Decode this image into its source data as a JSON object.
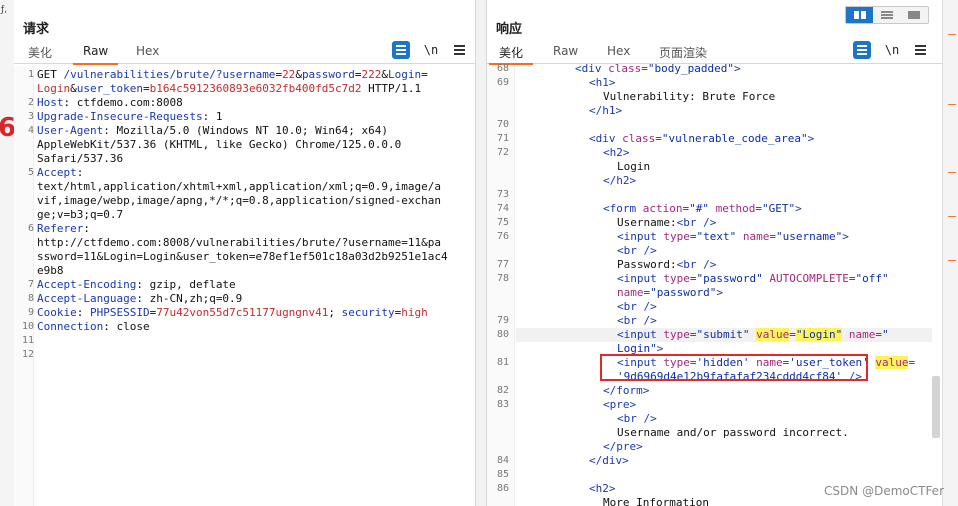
{
  "request_pane": {
    "title": "请求",
    "tabs": [
      "美化",
      "Raw",
      "Hex"
    ],
    "active_tab": "Raw",
    "newline_toggle": "\\n",
    "lines": [
      {
        "n": "1",
        "parts": [
          [
            "t",
            "GET "
          ],
          [
            "b",
            "/vulnerabilities/brute/?"
          ],
          [
            "k",
            "username"
          ],
          [
            "t",
            "="
          ],
          [
            "r",
            "22"
          ],
          [
            "t",
            "&"
          ],
          [
            "k",
            "password"
          ],
          [
            "t",
            "="
          ],
          [
            "r",
            "222"
          ],
          [
            "t",
            "&"
          ],
          [
            "k",
            "Login"
          ],
          [
            "t",
            "="
          ]
        ]
      },
      {
        "n": "",
        "parts": [
          [
            "r",
            "Login"
          ],
          [
            "t",
            "&"
          ],
          [
            "k",
            "user_token"
          ],
          [
            "t",
            "="
          ],
          [
            "r",
            "b164c5912360893e6032fb400fd5c7d2"
          ],
          [
            "t",
            " HTTP/1.1"
          ]
        ]
      },
      {
        "n": "2",
        "parts": [
          [
            "k",
            "Host"
          ],
          [
            "t",
            ": ctfdemo.com:8008"
          ]
        ]
      },
      {
        "n": "3",
        "parts": [
          [
            "k",
            "Upgrade-Insecure-Requests"
          ],
          [
            "t",
            ": 1"
          ]
        ]
      },
      {
        "n": "4",
        "parts": [
          [
            "k",
            "User-Agent"
          ],
          [
            "t",
            ": Mozilla/5.0 (Windows NT 10.0; Win64; x64)"
          ]
        ]
      },
      {
        "n": "",
        "parts": [
          [
            "t",
            "AppleWebKit/537.36 (KHTML, like Gecko) Chrome/125.0.0.0"
          ]
        ]
      },
      {
        "n": "",
        "parts": [
          [
            "t",
            "Safari/537.36"
          ]
        ]
      },
      {
        "n": "5",
        "parts": [
          [
            "k",
            "Accept"
          ],
          [
            "t",
            ":"
          ]
        ]
      },
      {
        "n": "",
        "parts": [
          [
            "t",
            "text/html,application/xhtml+xml,application/xml;q=0.9,image/a"
          ]
        ]
      },
      {
        "n": "",
        "parts": [
          [
            "t",
            "vif,image/webp,image/apng,*/*;q=0.8,application/signed-exchan"
          ]
        ]
      },
      {
        "n": "",
        "parts": [
          [
            "t",
            "ge;v=b3;q=0.7"
          ]
        ]
      },
      {
        "n": "6",
        "parts": [
          [
            "k",
            "Referer"
          ],
          [
            "t",
            ":"
          ]
        ]
      },
      {
        "n": "",
        "parts": [
          [
            "t",
            "http://ctfdemo.com:8008/vulnerabilities/brute/?username=11&pa"
          ]
        ]
      },
      {
        "n": "",
        "parts": [
          [
            "t",
            "ssword=11&Login=Login&user_token=e78ef1ef501c18a03d2b9251e1ac4"
          ]
        ]
      },
      {
        "n": "",
        "parts": [
          [
            "t",
            "e9b8"
          ]
        ]
      },
      {
        "n": "7",
        "parts": [
          [
            "k",
            "Accept-Encoding"
          ],
          [
            "t",
            ": gzip, deflate"
          ]
        ]
      },
      {
        "n": "8",
        "parts": [
          [
            "k",
            "Accept-Language"
          ],
          [
            "t",
            ": zh-CN,zh;q=0.9"
          ]
        ]
      },
      {
        "n": "9",
        "parts": [
          [
            "k",
            "Cookie"
          ],
          [
            "t",
            ": "
          ],
          [
            "k",
            "PHPSESSID"
          ],
          [
            "t",
            "="
          ],
          [
            "r",
            "77u42von55d7c51177ugngnv41"
          ],
          [
            "t",
            "; "
          ],
          [
            "k",
            "security"
          ],
          [
            "t",
            "="
          ],
          [
            "r",
            "high"
          ]
        ]
      },
      {
        "n": "10",
        "parts": [
          [
            "k",
            "Connection"
          ],
          [
            "t",
            ": close"
          ]
        ]
      },
      {
        "n": "11",
        "parts": []
      },
      {
        "n": "12",
        "parts": []
      }
    ]
  },
  "response_pane": {
    "title": "响应",
    "tabs": [
      "美化",
      "Raw",
      "Hex",
      "页面渲染"
    ],
    "active_tab": "美化",
    "newline_toggle": "\\n",
    "lines": [
      {
        "n": "68",
        "indent": 4,
        "parts": [
          [
            "tag",
            "<div "
          ],
          [
            "attr",
            "class"
          ],
          [
            "tag",
            "="
          ],
          [
            "str",
            "\"body_padded\""
          ],
          [
            "tag",
            ">"
          ]
        ]
      },
      {
        "n": "69",
        "indent": 5,
        "parts": [
          [
            "tag",
            "<h1>"
          ]
        ]
      },
      {
        "n": "",
        "indent": 6,
        "parts": [
          [
            "txt",
            "Vulnerability: Brute Force"
          ]
        ]
      },
      {
        "n": "",
        "indent": 5,
        "parts": [
          [
            "tag",
            "</h1>"
          ]
        ]
      },
      {
        "n": "70",
        "indent": 0,
        "parts": []
      },
      {
        "n": "71",
        "indent": 5,
        "parts": [
          [
            "tag",
            "<div "
          ],
          [
            "attr",
            "class"
          ],
          [
            "tag",
            "="
          ],
          [
            "str",
            "\"vulnerable_code_area\""
          ],
          [
            "tag",
            ">"
          ]
        ]
      },
      {
        "n": "72",
        "indent": 6,
        "parts": [
          [
            "tag",
            "<h2>"
          ]
        ]
      },
      {
        "n": "",
        "indent": 7,
        "parts": [
          [
            "txt",
            "Login"
          ]
        ]
      },
      {
        "n": "",
        "indent": 6,
        "parts": [
          [
            "tag",
            "</h2>"
          ]
        ]
      },
      {
        "n": "73",
        "indent": 0,
        "parts": []
      },
      {
        "n": "74",
        "indent": 6,
        "parts": [
          [
            "tag",
            "<form "
          ],
          [
            "attr",
            "action"
          ],
          [
            "tag",
            "="
          ],
          [
            "str",
            "\"#\""
          ],
          [
            "tag",
            " "
          ],
          [
            "attr",
            "method"
          ],
          [
            "tag",
            "="
          ],
          [
            "str",
            "\"GET\""
          ],
          [
            "tag",
            ">"
          ]
        ]
      },
      {
        "n": "75",
        "indent": 7,
        "parts": [
          [
            "txt",
            "Username:"
          ],
          [
            "tag",
            "<br />"
          ]
        ]
      },
      {
        "n": "76",
        "indent": 7,
        "parts": [
          [
            "tag",
            "<input "
          ],
          [
            "attr",
            "type"
          ],
          [
            "tag",
            "="
          ],
          [
            "str",
            "\"text\""
          ],
          [
            "tag",
            " "
          ],
          [
            "attr",
            "name"
          ],
          [
            "tag",
            "="
          ],
          [
            "str",
            "\"username\""
          ],
          [
            "tag",
            ">"
          ]
        ]
      },
      {
        "n": "",
        "indent": 7,
        "parts": [
          [
            "tag",
            "<br />"
          ]
        ]
      },
      {
        "n": "77",
        "indent": 7,
        "parts": [
          [
            "txt",
            "Password:"
          ],
          [
            "tag",
            "<br />"
          ]
        ]
      },
      {
        "n": "78",
        "indent": 7,
        "parts": [
          [
            "tag",
            "<input "
          ],
          [
            "attr",
            "type"
          ],
          [
            "tag",
            "="
          ],
          [
            "str",
            "\"password\""
          ],
          [
            "tag",
            " "
          ],
          [
            "attr",
            "AUTOCOMPLETE"
          ],
          [
            "tag",
            "="
          ],
          [
            "str",
            "\"off\""
          ]
        ]
      },
      {
        "n": "",
        "indent": 7,
        "parts": [
          [
            "attr",
            "name"
          ],
          [
            "tag",
            "="
          ],
          [
            "str",
            "\"password\""
          ],
          [
            "tag",
            ">"
          ]
        ]
      },
      {
        "n": "",
        "indent": 7,
        "parts": [
          [
            "tag",
            "<br />"
          ]
        ]
      },
      {
        "n": "79",
        "indent": 7,
        "parts": [
          [
            "tag",
            "<br />"
          ]
        ]
      },
      {
        "n": "80",
        "indent": 7,
        "sel": true,
        "parts": [
          [
            "tag",
            "<input "
          ],
          [
            "attr",
            "type"
          ],
          [
            "tag",
            "="
          ],
          [
            "str",
            "\"submit\""
          ],
          [
            "tag",
            " "
          ],
          [
            "hlattr",
            "value"
          ],
          [
            "tag",
            "="
          ],
          [
            "hlstr",
            "\"Login\""
          ],
          [
            "tag",
            " "
          ],
          [
            "attr",
            "name"
          ],
          [
            "tag",
            "="
          ],
          [
            "str",
            "\""
          ]
        ]
      },
      {
        "n": "",
        "indent": 7,
        "parts": [
          [
            "str",
            "Login\""
          ],
          [
            "tag",
            ">"
          ]
        ]
      },
      {
        "n": "81",
        "indent": 7,
        "parts": [
          [
            "tag",
            "<input "
          ],
          [
            "attr",
            "type"
          ],
          [
            "tag",
            "="
          ],
          [
            "str",
            "'hidden'"
          ],
          [
            "tag",
            " "
          ],
          [
            "attr",
            "name"
          ],
          [
            "tag",
            "="
          ],
          [
            "str",
            "'user_token'"
          ],
          [
            "tag",
            " "
          ],
          [
            "hlattr",
            "value"
          ],
          [
            "tag",
            "="
          ]
        ]
      },
      {
        "n": "",
        "indent": 7,
        "parts": [
          [
            "str",
            "'9d6969d4e12b9fafafaf234cddd4cf84'"
          ],
          [
            "tag",
            " />"
          ]
        ]
      },
      {
        "n": "82",
        "indent": 6,
        "parts": [
          [
            "tag",
            "</form>"
          ]
        ]
      },
      {
        "n": "83",
        "indent": 6,
        "parts": [
          [
            "tag",
            "<pre>"
          ]
        ]
      },
      {
        "n": "",
        "indent": 7,
        "parts": [
          [
            "tag",
            "<br />"
          ]
        ]
      },
      {
        "n": "",
        "indent": 7,
        "parts": [
          [
            "txt",
            "Username and/or password incorrect."
          ]
        ]
      },
      {
        "n": "",
        "indent": 6,
        "parts": [
          [
            "tag",
            "</pre>"
          ]
        ]
      },
      {
        "n": "84",
        "indent": 5,
        "parts": [
          [
            "tag",
            "</div>"
          ]
        ]
      },
      {
        "n": "85",
        "indent": 0,
        "parts": []
      },
      {
        "n": "86",
        "indent": 5,
        "parts": [
          [
            "tag",
            "<h2>"
          ]
        ]
      },
      {
        "n": "",
        "indent": 6,
        "parts": [
          [
            "txt",
            "More Information"
          ]
        ]
      }
    ]
  },
  "left_strip": {
    "top": "ƒ,"
  },
  "watermark": "CSDN @DemoCTFer"
}
